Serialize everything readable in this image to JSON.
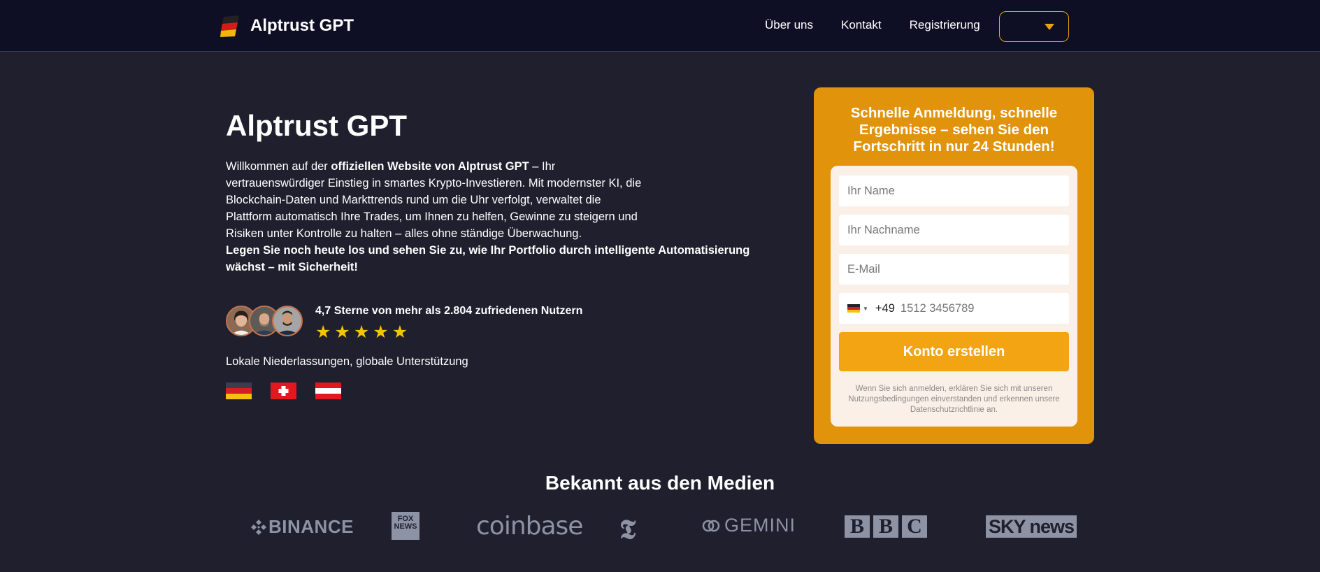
{
  "header": {
    "brand": "Alptrust GPT",
    "nav": [
      "Über uns",
      "Kontakt",
      "Registrierung"
    ],
    "language_selector": ""
  },
  "hero": {
    "title": "Alptrust GPT",
    "intro_prefix": "Willkommen auf der ",
    "intro_bold": "offiziellen Website von Alptrust GPT",
    "intro_rest": " – Ihr vertrauenswürdiger Einstieg in smartes Krypto-Investieren. Mit modernster KI, die Blockchain-Daten und Markttrends rund um die Uhr verfolgt, verwaltet die Plattform automatisch Ihre Trades, um Ihnen zu helfen, Gewinne zu steigern und Risiken unter Kontrolle zu halten – alles ohne ständige Überwachung.",
    "cta": "Legen Sie noch heute los und sehen Sie zu, wie Ihr Portfolio durch intelligente Automatisierung wächst – mit Sicherheit!",
    "rating_text": "4,7 Sterne von mehr als 2.804 zufriedenen Nutzern",
    "rating_value": 4.7,
    "stars": 5,
    "local_text": "Lokale Niederlassungen, globale Unterstützung",
    "flags": [
      "germany-flag",
      "switzerland-flag",
      "austria-flag"
    ]
  },
  "form": {
    "title": "Schnelle Anmeldung, schnelle Ergebnisse – sehen Sie den Fortschritt in nur 24 Stunden!",
    "first_name_placeholder": "Ihr Name",
    "last_name_placeholder": "Ihr Nachname",
    "email_placeholder": "E-Mail",
    "phone_code": "+49",
    "phone_placeholder": "1512 3456789",
    "submit": "Konto erstellen",
    "disclaimer": "Wenn Sie sich anmelden, erklären Sie sich mit unseren Nutzungsbedingungen einverstanden und erkennen unsere Datenschutzrichtlinie an."
  },
  "media": {
    "title": "Bekannt aus den Medien",
    "binance": "BINANCE",
    "fox_line1": "FOX",
    "fox_line2": "NEWS",
    "coinbase": "coinbase",
    "nyt": "𝕿",
    "gemini": "GEMINI",
    "bbc": [
      "B",
      "B",
      "C"
    ],
    "sky": "SKY news"
  },
  "colors": {
    "accent": "#e0930b",
    "button": "#f3a412",
    "header_bg": "#0e0f24",
    "page_bg": "#1f1f2e",
    "star": "#f5c400"
  }
}
